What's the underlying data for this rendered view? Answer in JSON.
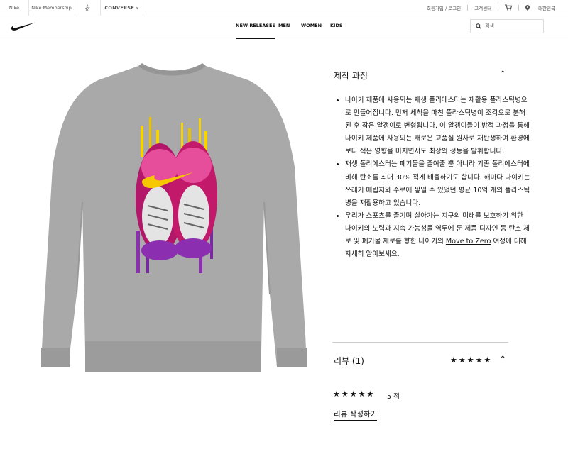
{
  "util_bar": {
    "brands": [
      "Nike",
      "Nike Membership",
      "Jordan",
      "CONVERSE"
    ],
    "links": [
      "회원가입 / 로그인",
      "고객센터"
    ],
    "region": "대한민국"
  },
  "nav": {
    "items": [
      "NEW RELEASES",
      "MEN",
      "WOMEN",
      "KIDS"
    ],
    "active": "NEW RELEASES",
    "search_placeholder": "검색"
  },
  "product": {
    "image_desc_color": "#a6a6a6",
    "accent_colors": [
      "#f7c800",
      "#c2196b",
      "#8b2fb0"
    ]
  },
  "details": {
    "title": "제작 과정",
    "bullets": [
      {
        "before": "나이키 제품에 사용되는 재생 폴리에스터는 재활용 플라스틱병으로 만들어집니다. 먼저 세척을 마친 플라스틱병이 조각으로 분해된 후 작은 알갱이로 변형됩니다. 이 알갱이들이 방적 과정을 통해 나이키 제품에 사용되는 새로운 고품질 원사로 재탄생하여 환경에 보다 적은 영향을 미치면서도 최상의 성능을 발휘합니다.",
        "link": "",
        "after": ""
      },
      {
        "before": "재생 폴리에스터는 폐기물을 줄여줄 뿐 아니라 기존 폴리에스터에 비해 탄소를 최대 30% 적게 배출하기도 합니다. 해마다 나이키는 쓰레기 매립지와 수로에 쌓일 수 있었던 평균 10억 개의 플라스틱병을 재활용하고 있습니다.",
        "link": "",
        "after": ""
      },
      {
        "before": "우리가 스포츠를 즐기며 살아가는 지구의 미래를 보호하기 위한 나이키의 노력과 지속 가능성을 염두에 둔 제품 디자인 등 탄소 제로 및 폐기물 제로를 향한 나이키의 ",
        "link": "Move to Zero",
        "after": " 여정에 대해 자세히 알아보세요."
      }
    ]
  },
  "reviews": {
    "title": "리뷰 (1)",
    "header_stars": "★★★★★",
    "stars": "★★★★★",
    "score": "5 점",
    "rating": 5,
    "max_rating": 5,
    "write_label": "리뷰 작성하기"
  }
}
